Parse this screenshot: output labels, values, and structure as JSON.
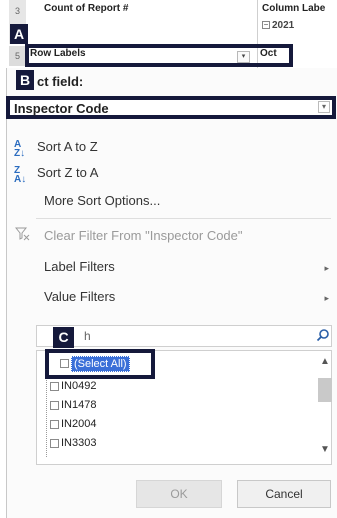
{
  "sheet": {
    "row3_number": "3",
    "row5_number": "5",
    "count_header": "Count of Report #",
    "column_labels_header": "Column Labe",
    "year_label": "2021",
    "row_labels_header": "Row Labels",
    "filter_arrow_glyph": "▾",
    "month_value": "Oct"
  },
  "callouts": {
    "a": "A",
    "b": "B",
    "c": "C"
  },
  "panel": {
    "select_field_label": "ct field:",
    "field_value": "Inspector Code",
    "sort_az": "Sort A to Z",
    "sort_za": "Sort Z to A",
    "more_sort": "More Sort Options...",
    "clear_filter": "Clear Filter From \"Inspector Code\"",
    "label_filters": "Label Filters",
    "value_filters": "Value Filters",
    "search_text": "h",
    "list_items": [
      "(Select All)",
      "IN0492",
      "IN1478",
      "IN2004",
      "IN3303"
    ],
    "ok_label": "OK",
    "cancel_label": "Cancel"
  },
  "icons": {
    "sort_az": "sort-az-icon",
    "sort_za": "sort-za-icon",
    "clear_filter": "funnel-clear-icon",
    "search": "search-icon",
    "dropdown": "chevron-down-icon"
  },
  "colors": {
    "highlight_border": "#15193b",
    "selection": "#3a6fd8",
    "sort_icon": "#2b6cbf"
  }
}
